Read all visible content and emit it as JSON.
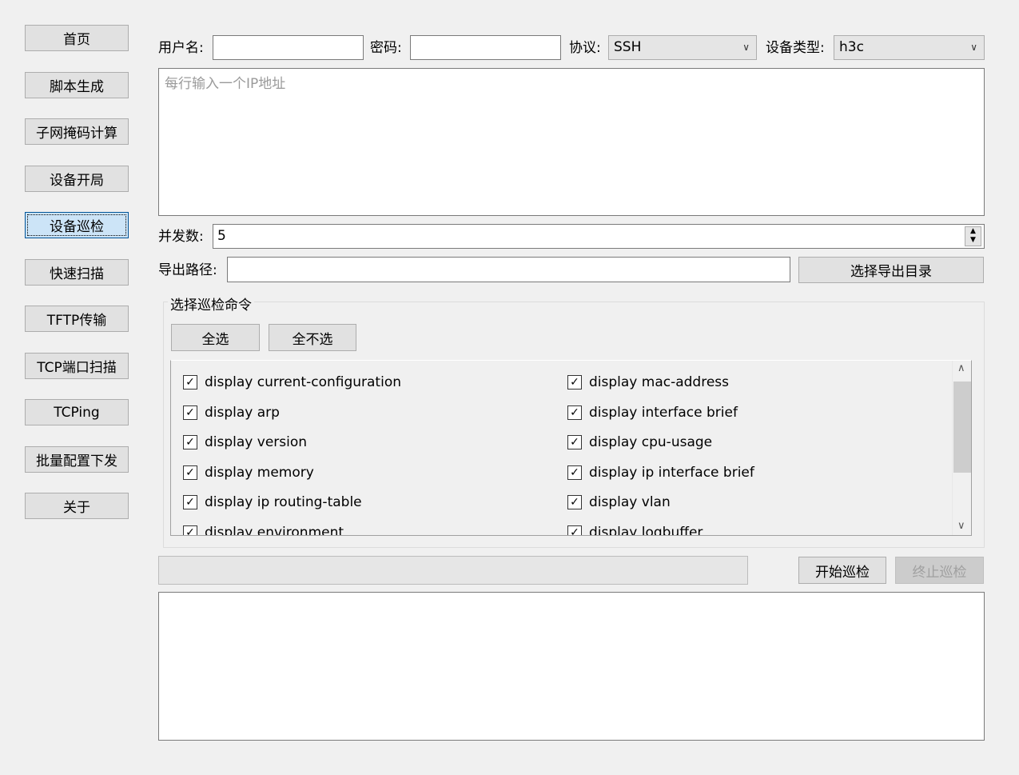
{
  "sidebar": {
    "items": [
      {
        "label": "首页"
      },
      {
        "label": "脚本生成"
      },
      {
        "label": "子网掩码计算"
      },
      {
        "label": "设备开局"
      },
      {
        "label": "设备巡检",
        "active": true
      },
      {
        "label": "快速扫描"
      },
      {
        "label": "TFTP传输"
      },
      {
        "label": "TCP端口扫描"
      },
      {
        "label": "TCPing"
      },
      {
        "label": "批量配置下发"
      },
      {
        "label": "关于"
      }
    ]
  },
  "form": {
    "username_label": "用户名:",
    "username_value": "",
    "password_label": "密码:",
    "password_value": "",
    "protocol_label": "协议:",
    "protocol_value": "SSH",
    "device_type_label": "设备类型:",
    "device_type_value": "h3c",
    "ip_placeholder": "每行输入一个IP地址",
    "concurrency_label": "并发数:",
    "concurrency_value": "5",
    "export_label": "导出路径:",
    "export_value": "",
    "export_button": "选择导出目录"
  },
  "commands": {
    "group_title": "选择巡检命令",
    "select_all": "全选",
    "select_none": "全不选",
    "items": [
      {
        "label": "display current-configuration",
        "checked": true
      },
      {
        "label": "display mac-address",
        "checked": true
      },
      {
        "label": "display arp",
        "checked": true
      },
      {
        "label": "display interface brief",
        "checked": true
      },
      {
        "label": "display version",
        "checked": true
      },
      {
        "label": "display cpu-usage",
        "checked": true
      },
      {
        "label": "display memory",
        "checked": true
      },
      {
        "label": "display ip interface brief",
        "checked": true
      },
      {
        "label": "display ip routing-table",
        "checked": true
      },
      {
        "label": "display vlan",
        "checked": true
      },
      {
        "label": "display environment",
        "checked": true
      },
      {
        "label": "display logbuffer",
        "checked": true
      }
    ]
  },
  "actions": {
    "start": "开始巡检",
    "stop": "终止巡检",
    "progress": 0
  },
  "output": {
    "text": ""
  }
}
